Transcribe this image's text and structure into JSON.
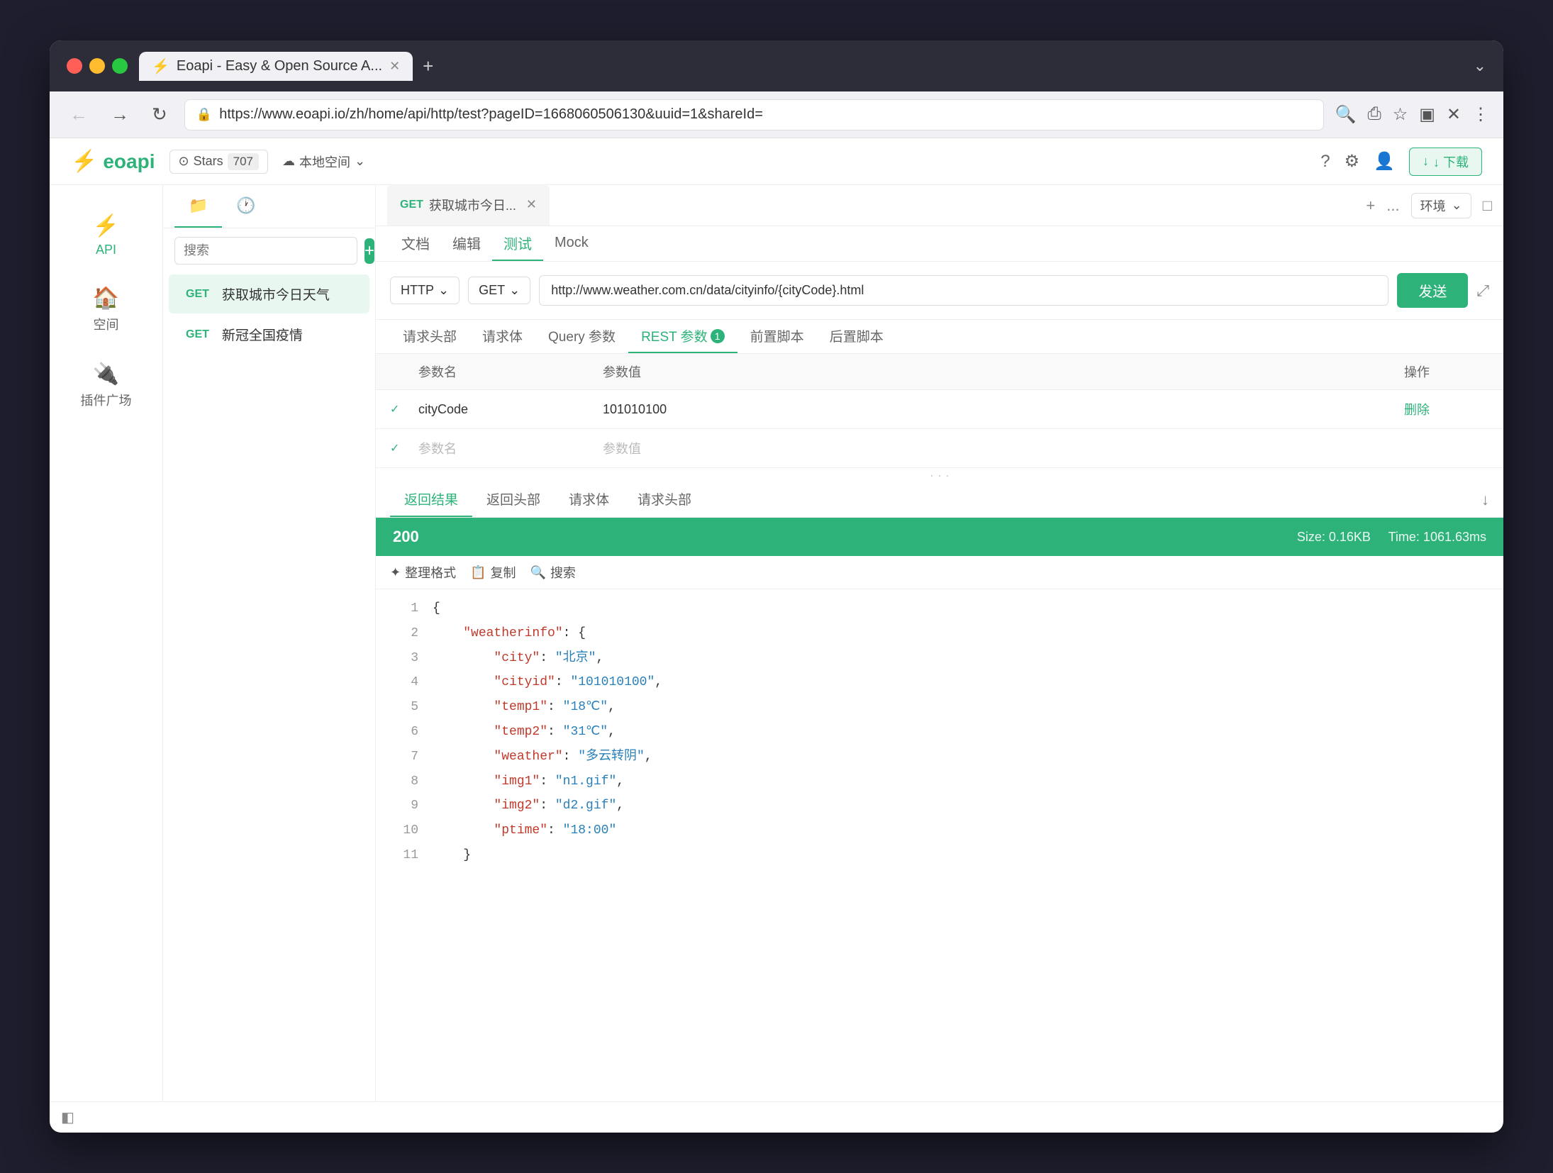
{
  "browser": {
    "tab_title": "Eoapi - Easy & Open Source A...",
    "tab_favicon": "⚡",
    "url": "https://www.eoapi.io/zh/home/api/http/test?pageID=1668060506130&uuid=1&shareId=",
    "new_tab_icon": "+",
    "chevron": "›"
  },
  "topbar": {
    "logo": "eoapi",
    "github_stars_label": "Stars",
    "github_stars_count": "707",
    "workspace_label": "本地空间",
    "help_icon": "?",
    "settings_icon": "⚙",
    "user_icon": "👤",
    "download_label": "↓ 下载"
  },
  "sidebar": {
    "items": [
      {
        "id": "api",
        "icon": "⚡",
        "label": "API"
      },
      {
        "id": "space",
        "icon": "🏠",
        "label": "空间"
      },
      {
        "id": "plugin",
        "icon": "🔌",
        "label": "插件广场"
      }
    ]
  },
  "api_panel": {
    "tabs": [
      {
        "id": "folder",
        "icon": "📁",
        "label": ""
      },
      {
        "id": "history",
        "icon": "🕐",
        "label": ""
      }
    ],
    "search_placeholder": "搜索",
    "add_label": "+",
    "items": [
      {
        "method": "GET",
        "name": "获取城市今日天气",
        "active": true
      },
      {
        "method": "GET",
        "name": "新冠全国疫情"
      }
    ]
  },
  "content": {
    "tab": {
      "method": "GET",
      "title": "获取城市今日...",
      "add_icon": "+",
      "more_icon": "...",
      "env_label": "环境",
      "screen_icon": "□"
    },
    "sub_nav": [
      {
        "id": "doc",
        "label": "文档"
      },
      {
        "id": "edit",
        "label": "编辑"
      },
      {
        "id": "test",
        "label": "测试",
        "active": true
      },
      {
        "id": "mock",
        "label": "Mock"
      }
    ],
    "request": {
      "protocol": "HTTP",
      "method": "GET",
      "url": "http://www.weather.com.cn/data/cityinfo/{cityCode}.html",
      "send_label": "发送",
      "expand_icon": "⤢"
    },
    "params_tabs": [
      {
        "id": "req_header",
        "label": "请求头部"
      },
      {
        "id": "req_body",
        "label": "请求体"
      },
      {
        "id": "query",
        "label": "Query 参数"
      },
      {
        "id": "rest",
        "label": "REST 参数",
        "active": true,
        "badge": "1"
      },
      {
        "id": "pre_script",
        "label": "前置脚本"
      },
      {
        "id": "post_script",
        "label": "后置脚本"
      }
    ],
    "params_table": {
      "headers": [
        "",
        "参数名",
        "参数值",
        "操作"
      ],
      "rows": [
        {
          "checked": true,
          "name": "cityCode",
          "value": "101010100",
          "action": "删除"
        },
        {
          "checked": true,
          "name": "",
          "value": "",
          "action": ""
        }
      ],
      "name_placeholder": "参数名",
      "value_placeholder": "参数值"
    },
    "results": {
      "tabs": [
        {
          "id": "return_body",
          "label": "返回结果",
          "active": true
        },
        {
          "id": "return_header",
          "label": "返回头部"
        },
        {
          "id": "req_body",
          "label": "请求体"
        },
        {
          "id": "req_header",
          "label": "请求头部"
        }
      ],
      "download_icon": "↓",
      "status_code": "200",
      "size_label": "Size: 0.16KB",
      "time_label": "Time: 1061.63ms",
      "toolbar": [
        {
          "id": "format",
          "icon": "✦",
          "label": "整理格式"
        },
        {
          "id": "copy",
          "icon": "📋",
          "label": "复制"
        },
        {
          "id": "search",
          "icon": "🔍",
          "label": "搜索"
        }
      ],
      "code_lines": [
        {
          "num": 1,
          "content": "{",
          "type": "brace"
        },
        {
          "num": 2,
          "content": "\"weatherinfo\": {",
          "key": "weatherinfo"
        },
        {
          "num": 3,
          "content": "\"city\": \"北京\",",
          "key": "city",
          "val": "北京"
        },
        {
          "num": 4,
          "content": "\"cityid\": \"101010100\",",
          "key": "cityid",
          "val": "101010100"
        },
        {
          "num": 5,
          "content": "\"temp1\": \"18℃\",",
          "key": "temp1",
          "val": "18℃"
        },
        {
          "num": 6,
          "content": "\"temp2\": \"31℃\",",
          "key": "temp2",
          "val": "31℃"
        },
        {
          "num": 7,
          "content": "\"weather\": \"多云转阴\",",
          "key": "weather",
          "val": "多云转阴"
        },
        {
          "num": 8,
          "content": "\"img1\": \"n1.gif\",",
          "key": "img1",
          "val": "n1.gif"
        },
        {
          "num": 9,
          "content": "\"img2\": \"d2.gif\",",
          "key": "img2",
          "val": "d2.gif"
        },
        {
          "num": 10,
          "content": "\"ptime\": \"18:00\"",
          "key": "ptime",
          "val": "18:00"
        },
        {
          "num": 11,
          "content": "}",
          "type": "brace"
        }
      ]
    }
  },
  "bottom_toggle_icon": "◧",
  "colors": {
    "primary": "#2db37a",
    "primary_light": "#e8f7f0"
  }
}
